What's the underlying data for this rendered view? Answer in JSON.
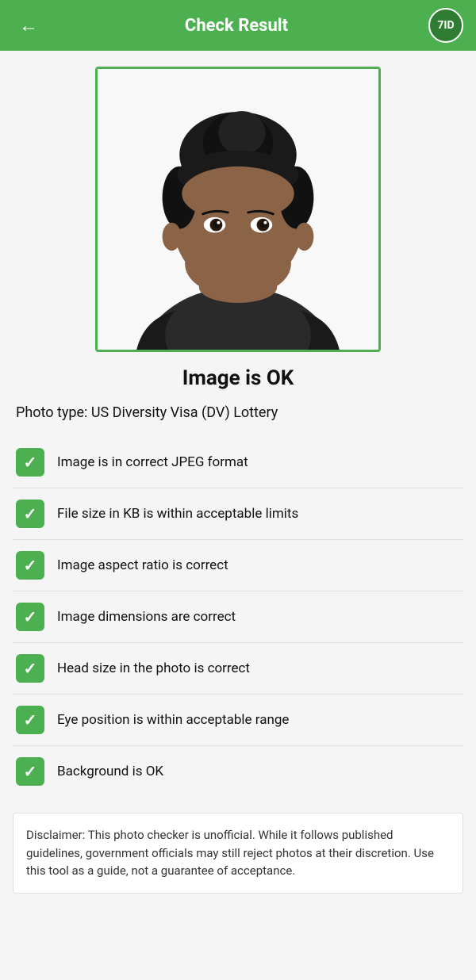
{
  "header": {
    "title": "Check Result",
    "back_icon": "←",
    "logo_text": "7ID"
  },
  "status": {
    "label": "Image is OK"
  },
  "photo_type": {
    "label": "Photo type: US Diversity Visa (DV) Lottery"
  },
  "checks": [
    {
      "id": "format",
      "text": "Image is in correct JPEG format",
      "passed": true
    },
    {
      "id": "filesize",
      "text": "File size in KB is within acceptable limits",
      "passed": true
    },
    {
      "id": "aspect",
      "text": "Image aspect ratio is correct",
      "passed": true
    },
    {
      "id": "dimensions",
      "text": "Image dimensions are correct",
      "passed": true
    },
    {
      "id": "headsize",
      "text": "Head size in the photo is correct",
      "passed": true
    },
    {
      "id": "eyeposition",
      "text": "Eye position is within acceptable range",
      "passed": true
    },
    {
      "id": "background",
      "text": "Background is OK",
      "passed": true
    }
  ],
  "disclaimer": {
    "text": "Disclaimer: This photo checker is unofficial. While it follows published guidelines, government officials may still reject photos at their discretion. Use this tool as a guide, not a guarantee of acceptance."
  }
}
